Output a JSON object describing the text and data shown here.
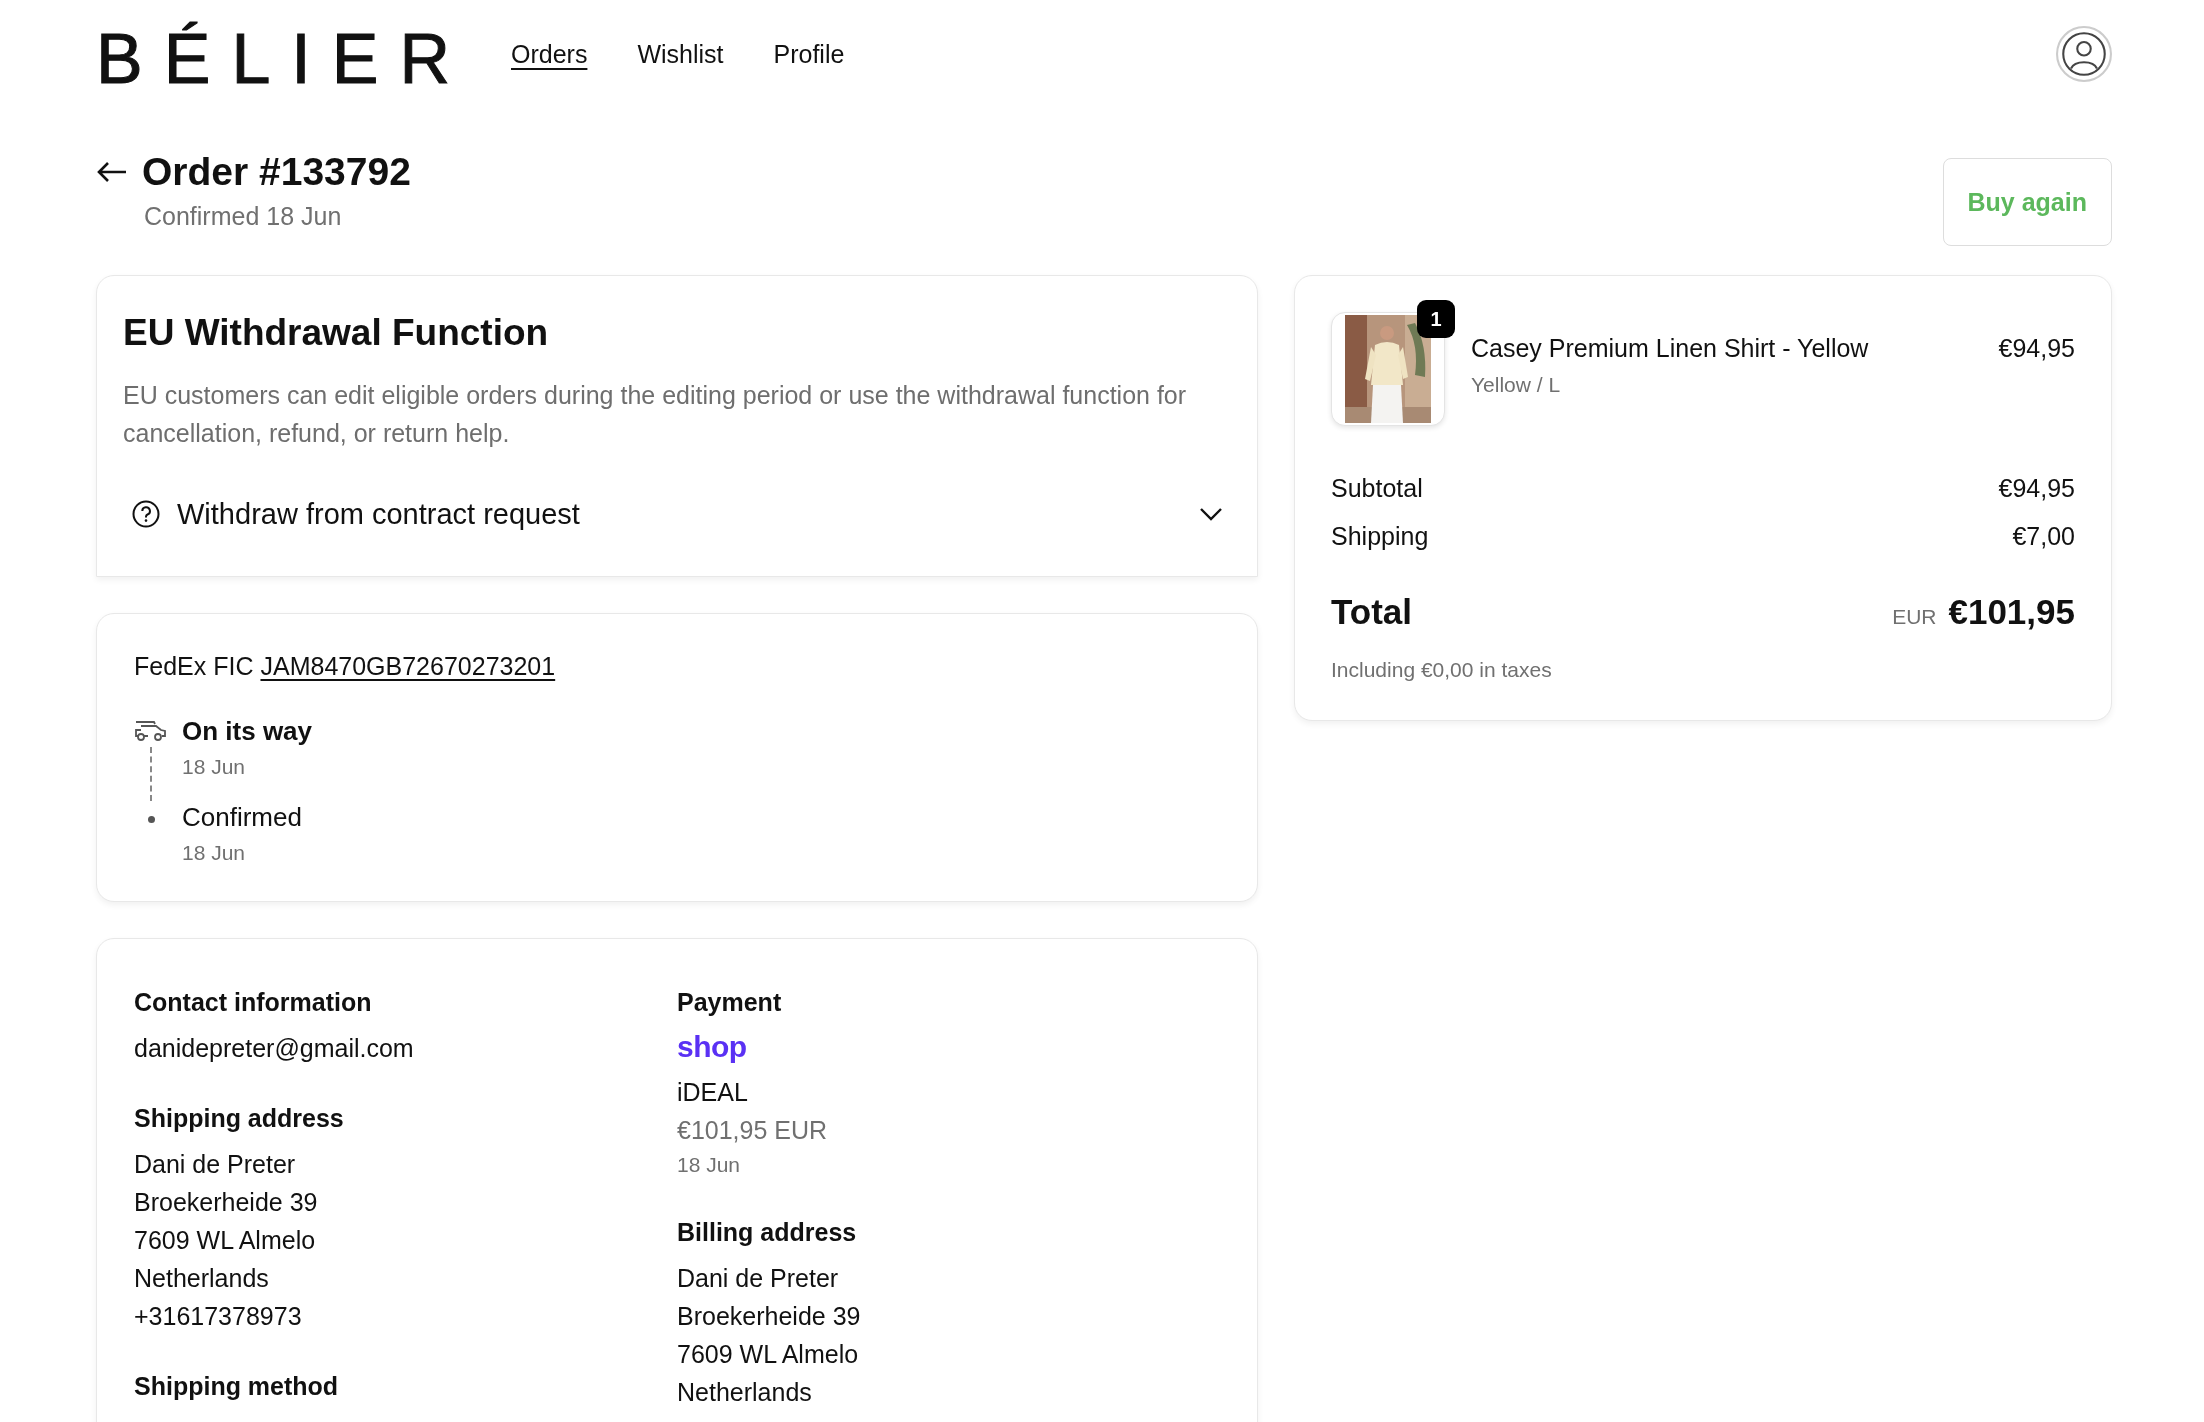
{
  "header": {
    "logo": "BÉLIER",
    "nav": [
      {
        "label": "Orders",
        "selected": true
      },
      {
        "label": "Wishlist",
        "selected": false
      },
      {
        "label": "Profile",
        "selected": false
      }
    ]
  },
  "order": {
    "title": "Order #133792",
    "subtitle": "Confirmed 18 Jun",
    "buy_again": "Buy again"
  },
  "withdrawal": {
    "title": "EU Withdrawal Function",
    "description": "EU customers can edit eligible orders during the editing period or use the withdrawal function for cancellation, refund, or return help.",
    "accordion": {
      "label": "Withdraw from contract request",
      "expanded": false
    }
  },
  "tracking": {
    "carrier": "FedEx FIC",
    "tracking_number": "JAM8470GB72670273201",
    "events": [
      {
        "kind": "truck",
        "status": "On its way",
        "date": "18 Jun",
        "current": true
      },
      {
        "kind": "dot",
        "status": "Confirmed",
        "date": "18 Jun",
        "current": false
      }
    ]
  },
  "details": {
    "columns": [
      [
        {
          "heading": "Contact information",
          "lines": [
            {
              "kind": "body",
              "text": "danidepreter@gmail.com"
            }
          ]
        },
        {
          "heading": "Shipping address",
          "lines": [
            {
              "kind": "body",
              "text": "Dani de Preter"
            },
            {
              "kind": "body",
              "text": "Broekerheide 39"
            },
            {
              "kind": "body",
              "text": "7609 WL Almelo"
            },
            {
              "kind": "body",
              "text": "Netherlands"
            },
            {
              "kind": "body",
              "text": "+31617378973"
            }
          ]
        },
        {
          "heading": "Shipping method"
        }
      ],
      [
        {
          "heading": "Payment",
          "lines": [
            {
              "kind": "logo",
              "text": "shop"
            },
            {
              "kind": "body",
              "text": "iDEAL"
            },
            {
              "kind": "muted",
              "text": "€101,95 EUR"
            },
            {
              "kind": "small",
              "text": "18 Jun"
            }
          ]
        },
        {
          "heading": "Billing address",
          "lines": [
            {
              "kind": "body",
              "text": "Dani de Preter"
            },
            {
              "kind": "body",
              "text": "Broekerheide 39"
            },
            {
              "kind": "body",
              "text": "7609 WL Almelo"
            },
            {
              "kind": "body",
              "text": "Netherlands"
            }
          ]
        }
      ]
    ]
  },
  "summary": {
    "items": [
      {
        "name": "Casey Premium Linen Shirt - Yellow",
        "variant": "Yellow / L",
        "price": "€94,95",
        "quantity": "1"
      }
    ],
    "rows": [
      {
        "label": "Subtotal",
        "value": "€94,95"
      },
      {
        "label": "Shipping",
        "value": "€7,00"
      }
    ],
    "total": {
      "label": "Total",
      "currency": "EUR",
      "value": "€101,95"
    },
    "taxes_note": "Including €0,00 in taxes"
  }
}
